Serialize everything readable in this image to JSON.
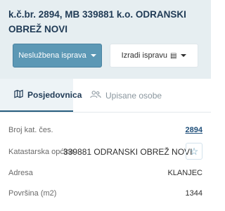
{
  "header": {
    "title": "k.č.br. 2894, MB 339881 k.o. ODRANSKI OBREŽ NOVI",
    "primary_button": "Neslužbena isprava",
    "secondary_button": "Izradi ispravu"
  },
  "tabs": [
    {
      "label": "Posjedovnica",
      "icon": "map-icon",
      "active": true
    },
    {
      "label": "Upisane osobe",
      "icon": "users-icon",
      "active": false
    }
  ],
  "fields": {
    "broj_label": "Broj kat. čes.",
    "broj_value": "2894",
    "opcina_label": "Katastarska općina",
    "opcina_value": "339881 ODRANSKI OBREŽ NOVI",
    "adresa_label": "Adresa",
    "adresa_value": "KLANJEC",
    "povrsina_label": "Površina (m2)",
    "povrsina_value": "1344"
  },
  "colors": {
    "header_bg": "#e6eef1",
    "primary": "#5c98b5",
    "title": "#1f3a55",
    "link": "#1f4f7a"
  }
}
